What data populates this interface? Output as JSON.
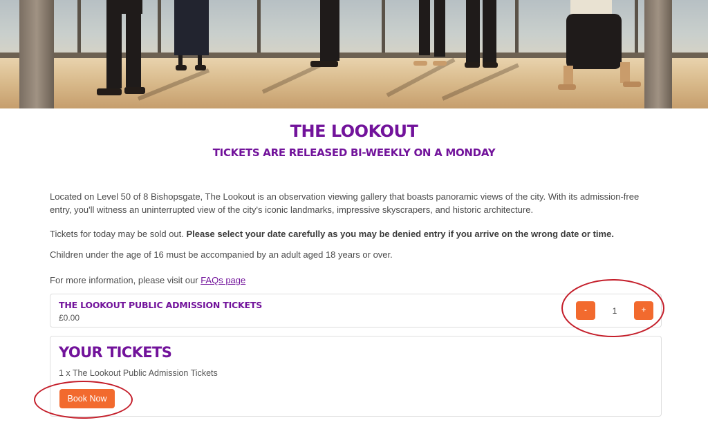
{
  "hero": {
    "image": "lookout-observation-gallery-photo"
  },
  "header": {
    "title": "THE LOOKOUT",
    "subtitle": "TICKETS ARE RELEASED BI-WEEKLY ON A MONDAY"
  },
  "info": {
    "description": "Located on Level 50 of 8 Bishopsgate, The Lookout is an observation viewing gallery that boasts panoramic views of the city. With its admission-free entry, you'll witness an uninterrupted view of the city's iconic landmarks, impressive skyscrapers, and historic architecture.",
    "sold_out_note": "Tickets for today may be sold out.",
    "date_warning": "Please select your date carefully as you may be denied entry if you arrive on the wrong date or time.",
    "children_note": "Children under the age of 16 must be accompanied by an adult aged 18 years or over.",
    "more_info_prefix": "For more information, please visit our ",
    "faq_link": "FAQs page"
  },
  "ticket": {
    "name": "THE LOOKOUT PUBLIC ADMISSION TICKETS",
    "price": "£0.00",
    "minus_label": "-",
    "plus_label": "+",
    "quantity": "1"
  },
  "basket": {
    "title": "YOUR TICKETS",
    "summary": "1 x The Lookout Public Admission Tickets",
    "book_label": "Book Now"
  },
  "colors": {
    "brand_purple": "#72139b",
    "accent_orange": "#f26a2e",
    "annotation_red": "#c41e2a"
  }
}
